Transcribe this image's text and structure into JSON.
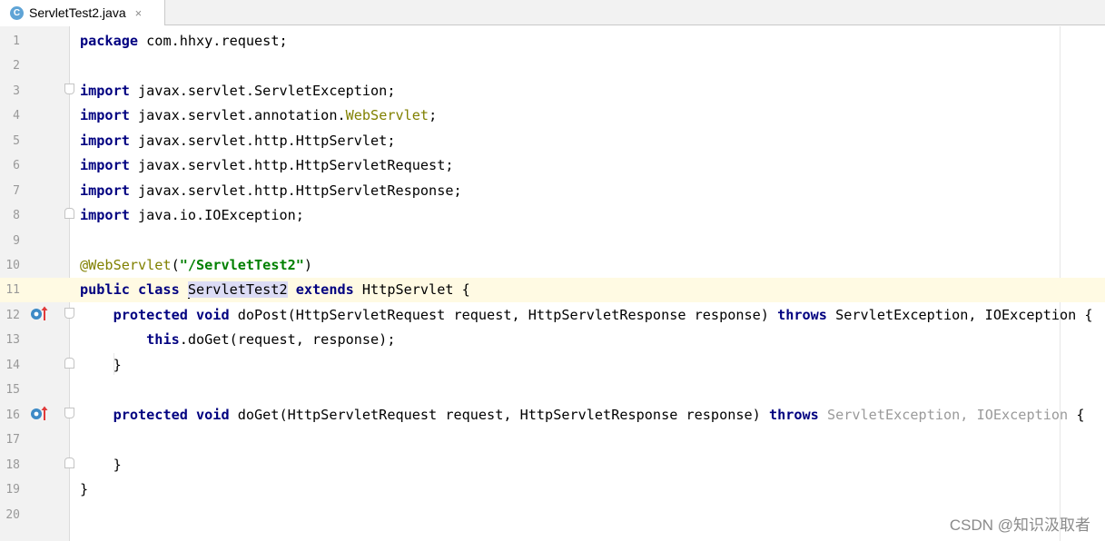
{
  "tab": {
    "icon_letter": "C",
    "filename": "ServletTest2.java",
    "close": "×"
  },
  "lines": {
    "n1": "1",
    "n2": "2",
    "n3": "3",
    "n4": "4",
    "n5": "5",
    "n6": "6",
    "n7": "7",
    "n8": "8",
    "n9": "9",
    "n10": "10",
    "n11": "11",
    "n12": "12",
    "n13": "13",
    "n14": "14",
    "n15": "15",
    "n16": "16",
    "n17": "17",
    "n18": "18",
    "n19": "19",
    "n20": "20"
  },
  "code": {
    "l1_kw": "package",
    "l1_rest": " com.hhxy.request;",
    "kw_import": "import",
    "l3_rest": " javax.servlet.ServletException;",
    "l4_pre": " javax.servlet.annotation.",
    "l4_ann": "WebServlet",
    "l4_end": ";",
    "l5_rest": " javax.servlet.http.HttpServlet;",
    "l6_rest": " javax.servlet.http.HttpServletRequest;",
    "l7_rest": " javax.servlet.http.HttpServletResponse;",
    "l8_rest": " java.io.IOException;",
    "l10_ann": "@WebServlet",
    "l10_open": "(",
    "l10_str": "\"/ServletTest2\"",
    "l10_close": ")",
    "l11_kw": "public class ",
    "l11_sel": "ServletTest2",
    "l11_kw2": " extends",
    "l11_rest": " HttpServlet {",
    "kw_protected_void": "protected void",
    "l12_rest": " doPost(HttpServletRequest request, HttpServletResponse response) ",
    "kw_throws": "throws",
    "l12_exc": " ServletException, IOException {",
    "l13_kw": "this",
    "l13_rest": ".doGet(request, response);",
    "close_brace": "}",
    "l16_rest": " doGet(HttpServletRequest request, HttpServletResponse response) ",
    "l16_exc1": "ServletException",
    "l16_comma": ", ",
    "l16_exc2": "IOException",
    "l16_open": " {"
  },
  "watermark": "CSDN @知识汲取者",
  "colors": {
    "keyword": "#000080",
    "annotation": "#808000",
    "string": "#008000",
    "current_line": "#fffae3",
    "selection": "#dcdcf5"
  }
}
